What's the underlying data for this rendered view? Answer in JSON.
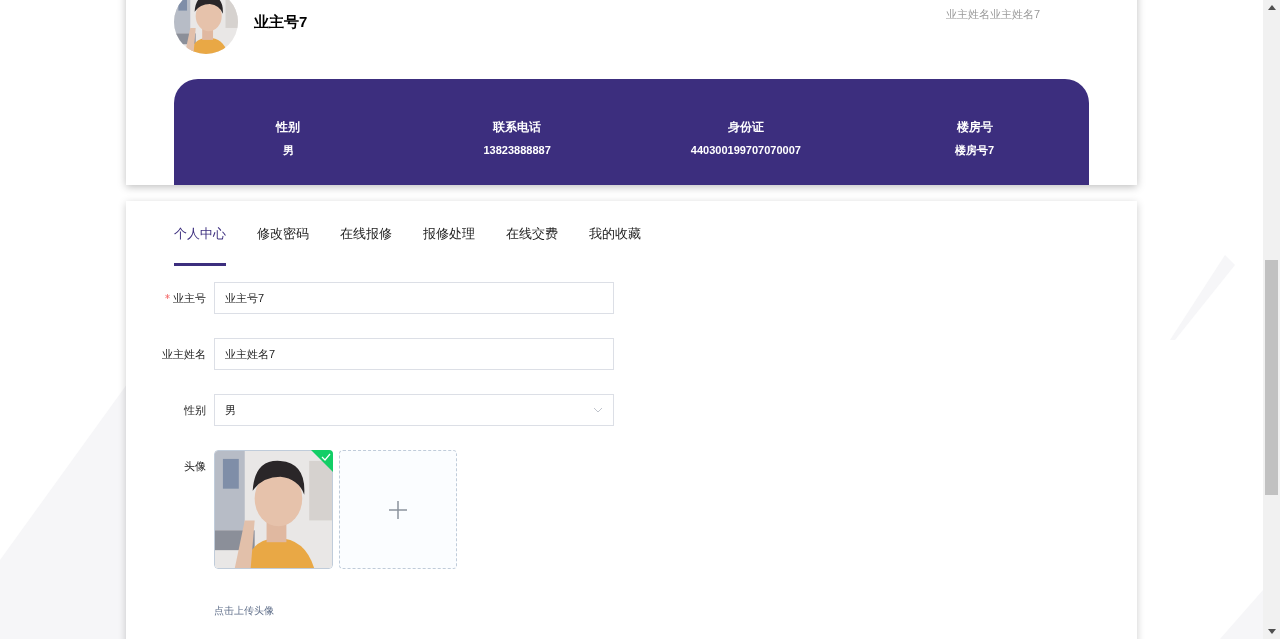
{
  "header": {
    "owner_no": "业主号7",
    "owner_name": "业主姓名业主姓名7"
  },
  "info": [
    {
      "label": "性别",
      "value": "男"
    },
    {
      "label": "联系电话",
      "value": "13823888887"
    },
    {
      "label": "身份证",
      "value": "440300199707070007"
    },
    {
      "label": "楼房号",
      "value": "楼房号7"
    }
  ],
  "tabs": [
    {
      "label": "个人中心",
      "selected": true
    },
    {
      "label": "修改密码",
      "selected": false
    },
    {
      "label": "在线报修",
      "selected": false
    },
    {
      "label": "报修处理",
      "selected": false
    },
    {
      "label": "在线交费",
      "selected": false
    },
    {
      "label": "我的收藏",
      "selected": false
    }
  ],
  "form": {
    "fields": [
      {
        "kind": "text",
        "label": "业主号",
        "required": true,
        "value": "业主号7"
      },
      {
        "kind": "text",
        "label": "业主姓名",
        "required": false,
        "value": "业主姓名7"
      },
      {
        "kind": "select",
        "label": "性别",
        "required": false,
        "value": "男"
      }
    ],
    "avatar": {
      "label": "头像",
      "uploaded": true,
      "hint": "点击上传头像"
    }
  }
}
